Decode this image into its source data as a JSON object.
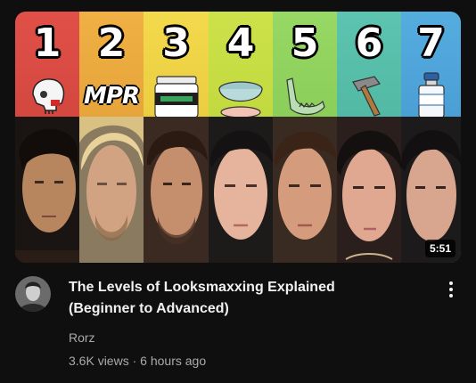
{
  "video": {
    "title_line1": "The Levels of Looksmaxxing Explained",
    "title_line2": "(Beginner to Advanced)",
    "channel": "Rorz",
    "views": "3.6K views",
    "separator": "·",
    "age": "6 hours ago",
    "duration": "5:51"
  },
  "thumbnail": {
    "levels": [
      "1",
      "2",
      "3",
      "4",
      "5",
      "6",
      "7"
    ],
    "level2_text": "MPR",
    "level_colors": [
      "#d64541",
      "#e8a83a",
      "#eed23f",
      "#c5dd3a",
      "#8fd15a",
      "#55b8a4",
      "#4aa2d8"
    ],
    "item_icons": [
      "skull-icon",
      "mpr-text",
      "supplement-jar-icon",
      "bowl-icon",
      "jaw-icon",
      "hammer-icon",
      "vial-icon"
    ]
  },
  "menu": {
    "icon": "more-vert-icon"
  }
}
